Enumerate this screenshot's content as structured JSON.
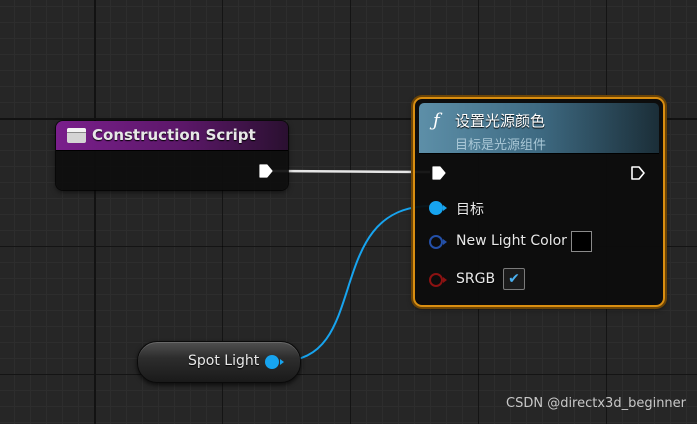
{
  "construction_node": {
    "title": "Construction Script",
    "header_color": "#7a1f8c"
  },
  "function_node": {
    "icon": "function-icon",
    "icon_glyph": "ƒ",
    "title": "设置光源颜色",
    "subtitle": "目标是光源组件",
    "header_color": "#5d8fa8",
    "selection_color": "#d98e11",
    "pins": {
      "target_label": "目标",
      "color_label": "New Light Color",
      "color_value": "#000000",
      "srgb_label": "SRGB",
      "srgb_checked": "✔"
    }
  },
  "spotlight_node": {
    "label": "Spot Light",
    "pin_color": "#17a4ef"
  },
  "wires": {
    "exec_color": "#e6e6e6",
    "object_color": "#17a4ef"
  },
  "watermark": "CSDN @directx3d_beginner"
}
